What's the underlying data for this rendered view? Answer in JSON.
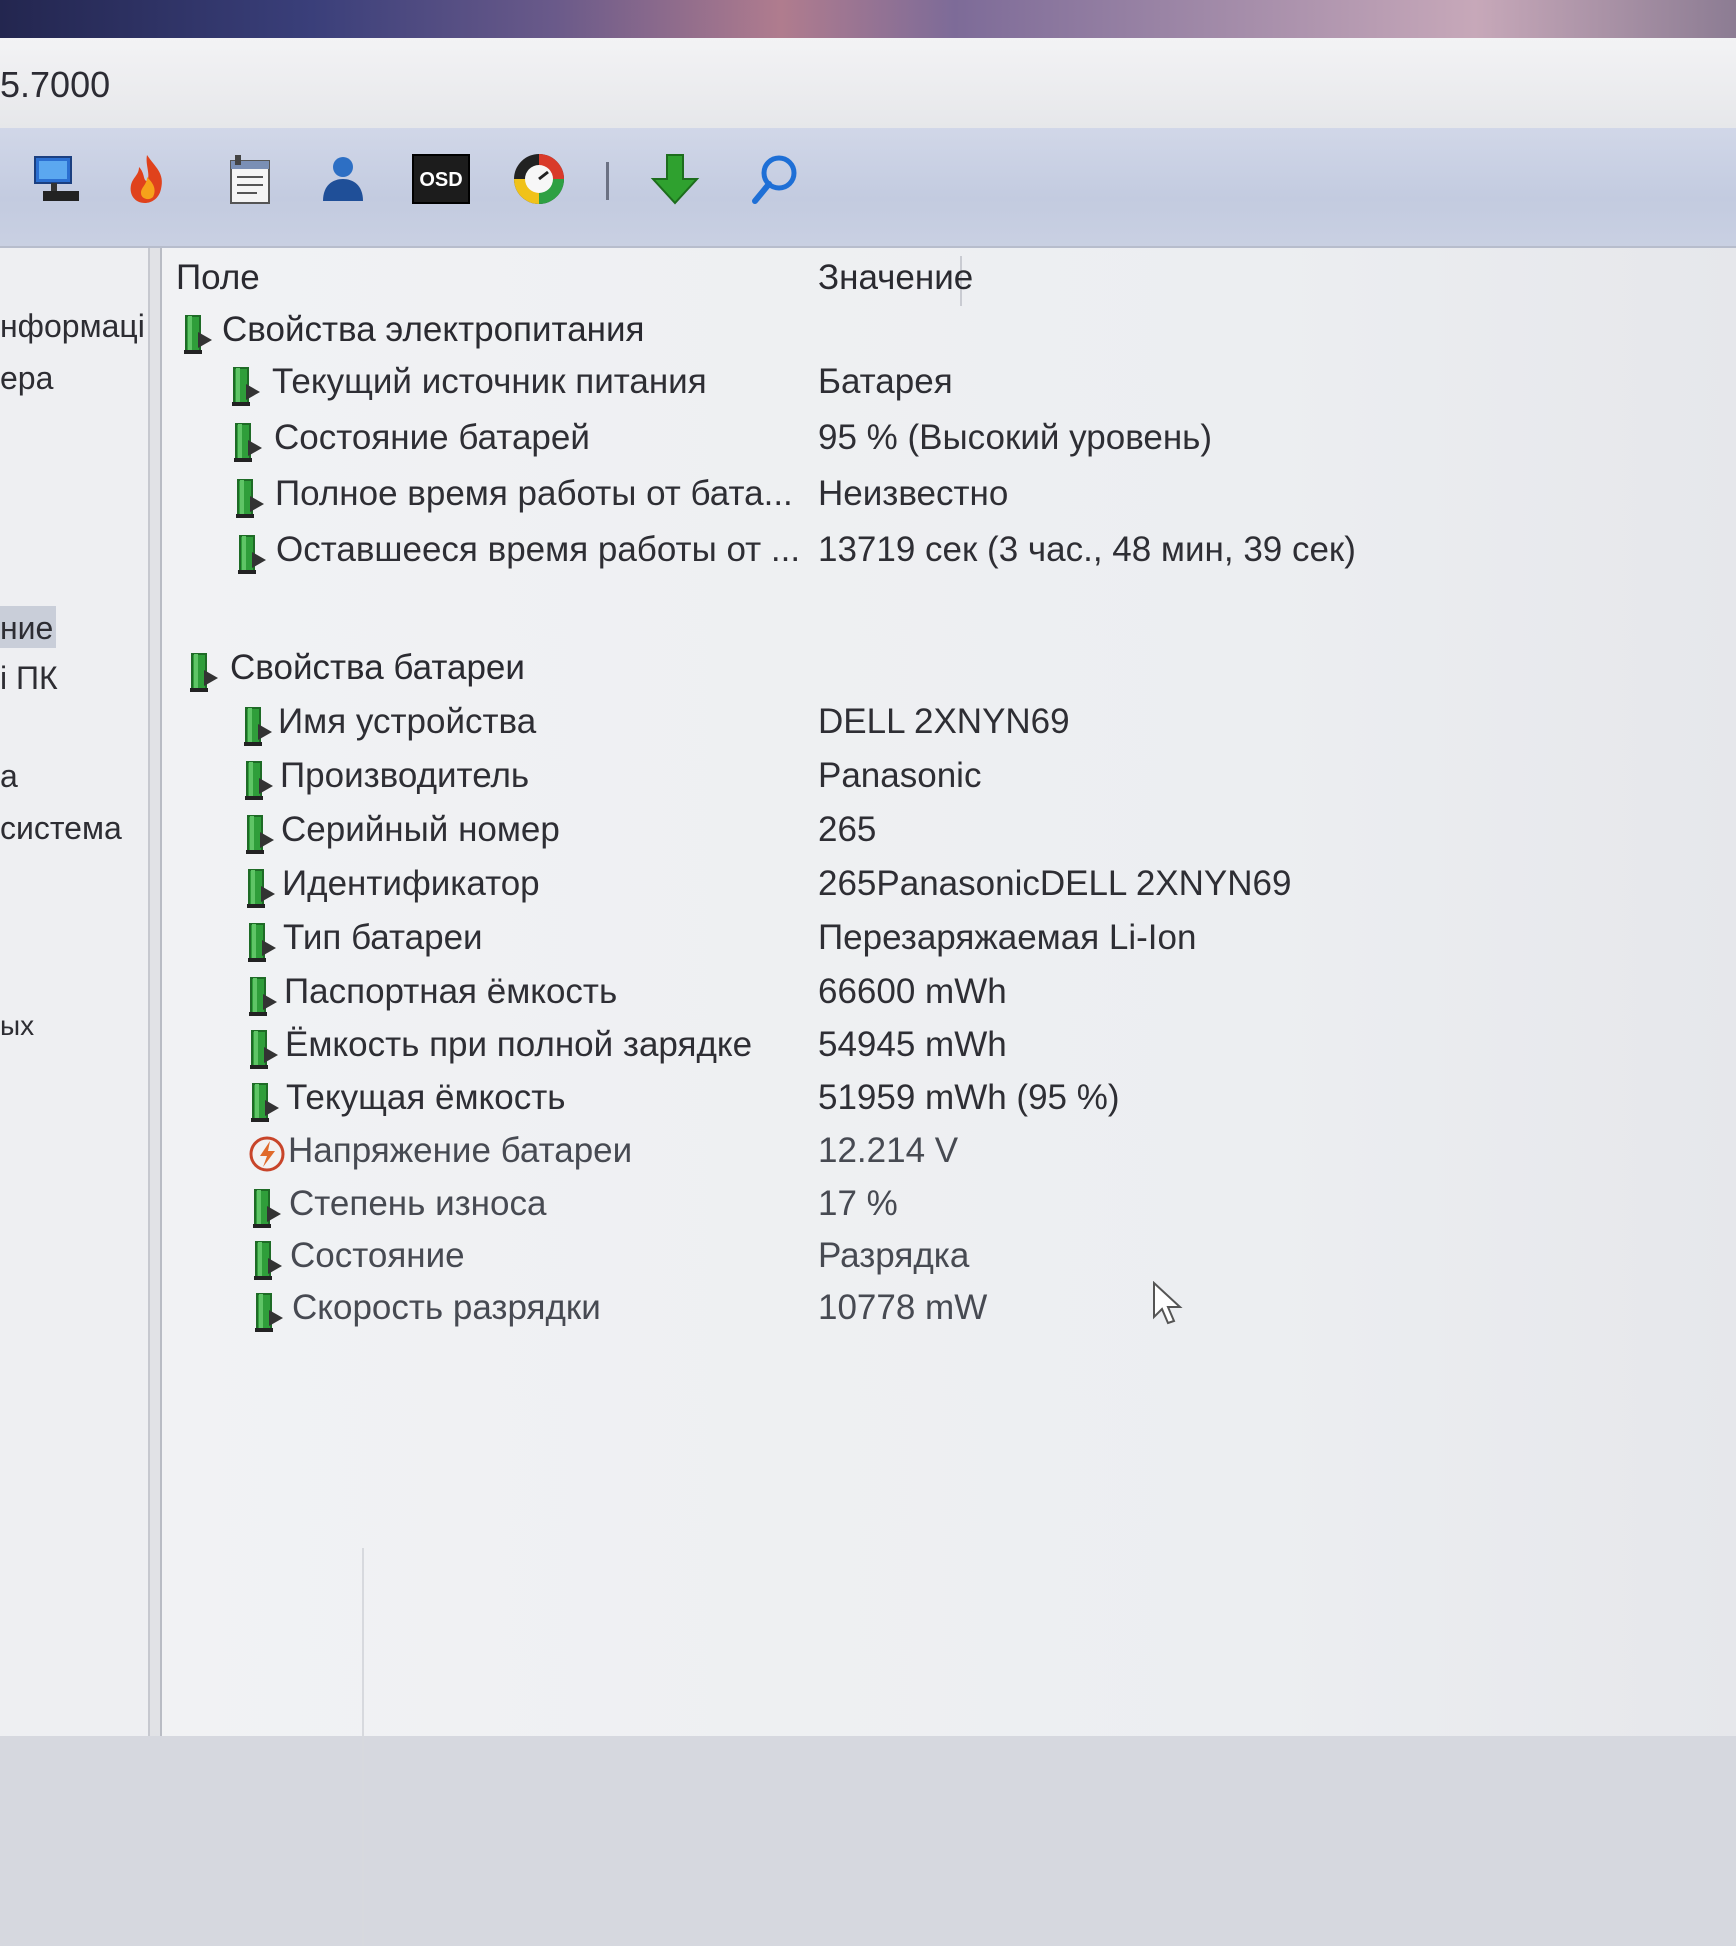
{
  "window": {
    "title_fragment": "5.7000"
  },
  "toolbar": {
    "buttons": [
      {
        "name": "computer-icon"
      },
      {
        "name": "flame-icon"
      },
      {
        "name": "report-icon"
      },
      {
        "name": "user-icon"
      },
      {
        "name": "osd-icon",
        "label": "OSD"
      },
      {
        "name": "monitor-gauge-icon"
      },
      {
        "name": "download-arrow-icon"
      },
      {
        "name": "search-icon"
      }
    ]
  },
  "sidebar": {
    "items": [
      "нформаці",
      "ера",
      "ние",
      "і ПК",
      "а",
      "система",
      "ых"
    ]
  },
  "table": {
    "columns": {
      "field": "Поле",
      "value": "Значение"
    },
    "groups": [
      {
        "title": "Свойства электропитания",
        "rows": [
          {
            "field": "Текущий источник питания",
            "value": "Батарея",
            "icon": "battery-icon"
          },
          {
            "field": "Состояние батарей",
            "value": "95 % (Высокий уровень)",
            "icon": "battery-icon"
          },
          {
            "field": "Полное время работы от бата...",
            "value": "Неизвестно",
            "icon": "battery-icon"
          },
          {
            "field": "Оставшееся время работы от ...",
            "value": "13719 сек (3 час., 48 мин, 39 сек)",
            "icon": "battery-icon"
          }
        ]
      },
      {
        "title": "Свойства батареи",
        "rows": [
          {
            "field": "Имя устройства",
            "value": "DELL 2XNYN69",
            "icon": "battery-icon"
          },
          {
            "field": "Производитель",
            "value": "Panasonic",
            "icon": "battery-icon"
          },
          {
            "field": "Серийный номер",
            "value": "265",
            "icon": "battery-icon"
          },
          {
            "field": "Идентификатор",
            "value": "265PanasonicDELL 2XNYN69",
            "icon": "battery-icon"
          },
          {
            "field": "Тип батареи",
            "value": "Перезаряжаемая Li-Ion",
            "icon": "battery-icon"
          },
          {
            "field": "Паспортная ёмкость",
            "value": "66600 mWh",
            "icon": "battery-icon"
          },
          {
            "field": "Ёмкость при полной зарядке",
            "value": "54945 mWh",
            "icon": "battery-icon"
          },
          {
            "field": "Текущая ёмкость",
            "value": "51959 mWh  (95 %)",
            "icon": "battery-icon"
          },
          {
            "field": "Напряжение батареи",
            "value": "12.214 V",
            "icon": "voltage-icon"
          },
          {
            "field": "Степень износа",
            "value": "17 %",
            "icon": "battery-icon"
          },
          {
            "field": "Состояние",
            "value": "Разрядка",
            "icon": "battery-icon"
          },
          {
            "field": "Скорость разрядки",
            "value": "10778 mW",
            "icon": "battery-icon"
          }
        ]
      }
    ]
  },
  "colors": {
    "battery_green": "#2f9e3a",
    "battery_dark": "#333333",
    "toolbar": "#c7cee2"
  }
}
